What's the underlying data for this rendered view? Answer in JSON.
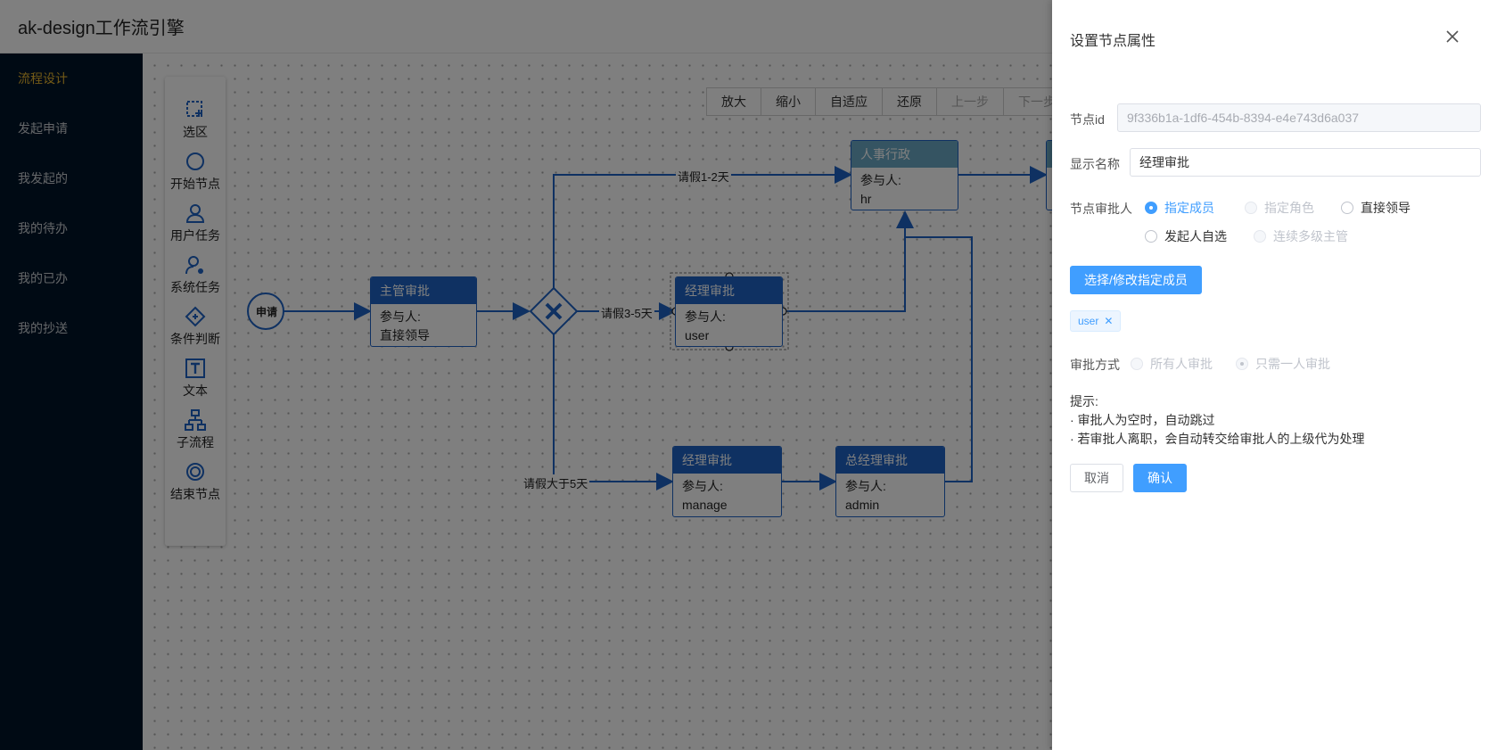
{
  "app": {
    "title": "ak-design工作流引擎"
  },
  "sidebar": {
    "items": [
      {
        "label": "流程设计",
        "active": true
      },
      {
        "label": "发起申请"
      },
      {
        "label": "我发起的"
      },
      {
        "label": "我的待办"
      },
      {
        "label": "我的已办"
      },
      {
        "label": "我的抄送"
      }
    ]
  },
  "palette": {
    "items": [
      {
        "label": "选区",
        "icon": "selection-icon"
      },
      {
        "label": "开始节点",
        "icon": "circle-icon"
      },
      {
        "label": "用户任务",
        "icon": "user-icon"
      },
      {
        "label": "系统任务",
        "icon": "user-gear-icon"
      },
      {
        "label": "条件判断",
        "icon": "diamond-icon"
      },
      {
        "label": "文本",
        "icon": "text-icon"
      },
      {
        "label": "子流程",
        "icon": "sitemap-icon"
      },
      {
        "label": "结束节点",
        "icon": "ring-icon"
      }
    ]
  },
  "toolbar": {
    "buttons": [
      {
        "label": "放大"
      },
      {
        "label": "缩小"
      },
      {
        "label": "自适应"
      },
      {
        "label": "还原"
      },
      {
        "label": "上一步",
        "disabled": true
      },
      {
        "label": "下一步",
        "disabled": true
      }
    ]
  },
  "diagram": {
    "start_label": "申请",
    "participant_label": "参与人:",
    "nodes": {
      "supervisor": {
        "title": "主管审批",
        "participant": "直接领导"
      },
      "manager_mid": {
        "title": "经理审批",
        "participant": "user"
      },
      "hr": {
        "title": "人事行政",
        "participant": "hr"
      },
      "manager_low": {
        "title": "经理审批",
        "participant": "manage"
      },
      "gm": {
        "title": "总经理审批",
        "participant": "admin"
      }
    },
    "edges": {
      "e1": "请假1-2天",
      "e2": "请假3-5天",
      "e3": "请假大于5天"
    },
    "colors": {
      "primary": "#1e63c4",
      "header_light": "#6aa8c4"
    }
  },
  "drawer": {
    "title": "设置节点属性",
    "node_id_label": "节点id",
    "node_id_value": "9f336b1a-1df6-454b-8394-e4e743d6a037",
    "display_name_label": "显示名称",
    "display_name_value": "经理审批",
    "approver_label": "节点审批人",
    "approver_options": [
      {
        "label": "指定成员",
        "checked": true
      },
      {
        "label": "指定角色",
        "disabled": true
      },
      {
        "label": "直接领导"
      },
      {
        "label": "发起人自选"
      },
      {
        "label": "连续多级主管",
        "disabled": true
      }
    ],
    "select_members_button": "选择/修改指定成员",
    "selected_members": [
      "user"
    ],
    "approve_mode_label": "审批方式",
    "approve_mode_options": [
      {
        "label": "所有人审批",
        "disabled": true
      },
      {
        "label": "只需一人审批",
        "disabled": true,
        "checked": true
      }
    ],
    "tips_title": "提示:",
    "tips": [
      "· 审批人为空时，自动跳过",
      "· 若审批人离职，会自动转交给审批人的上级代为处理"
    ],
    "cancel_button": "取消",
    "confirm_button": "确认",
    "accent_color": "#409eff"
  }
}
